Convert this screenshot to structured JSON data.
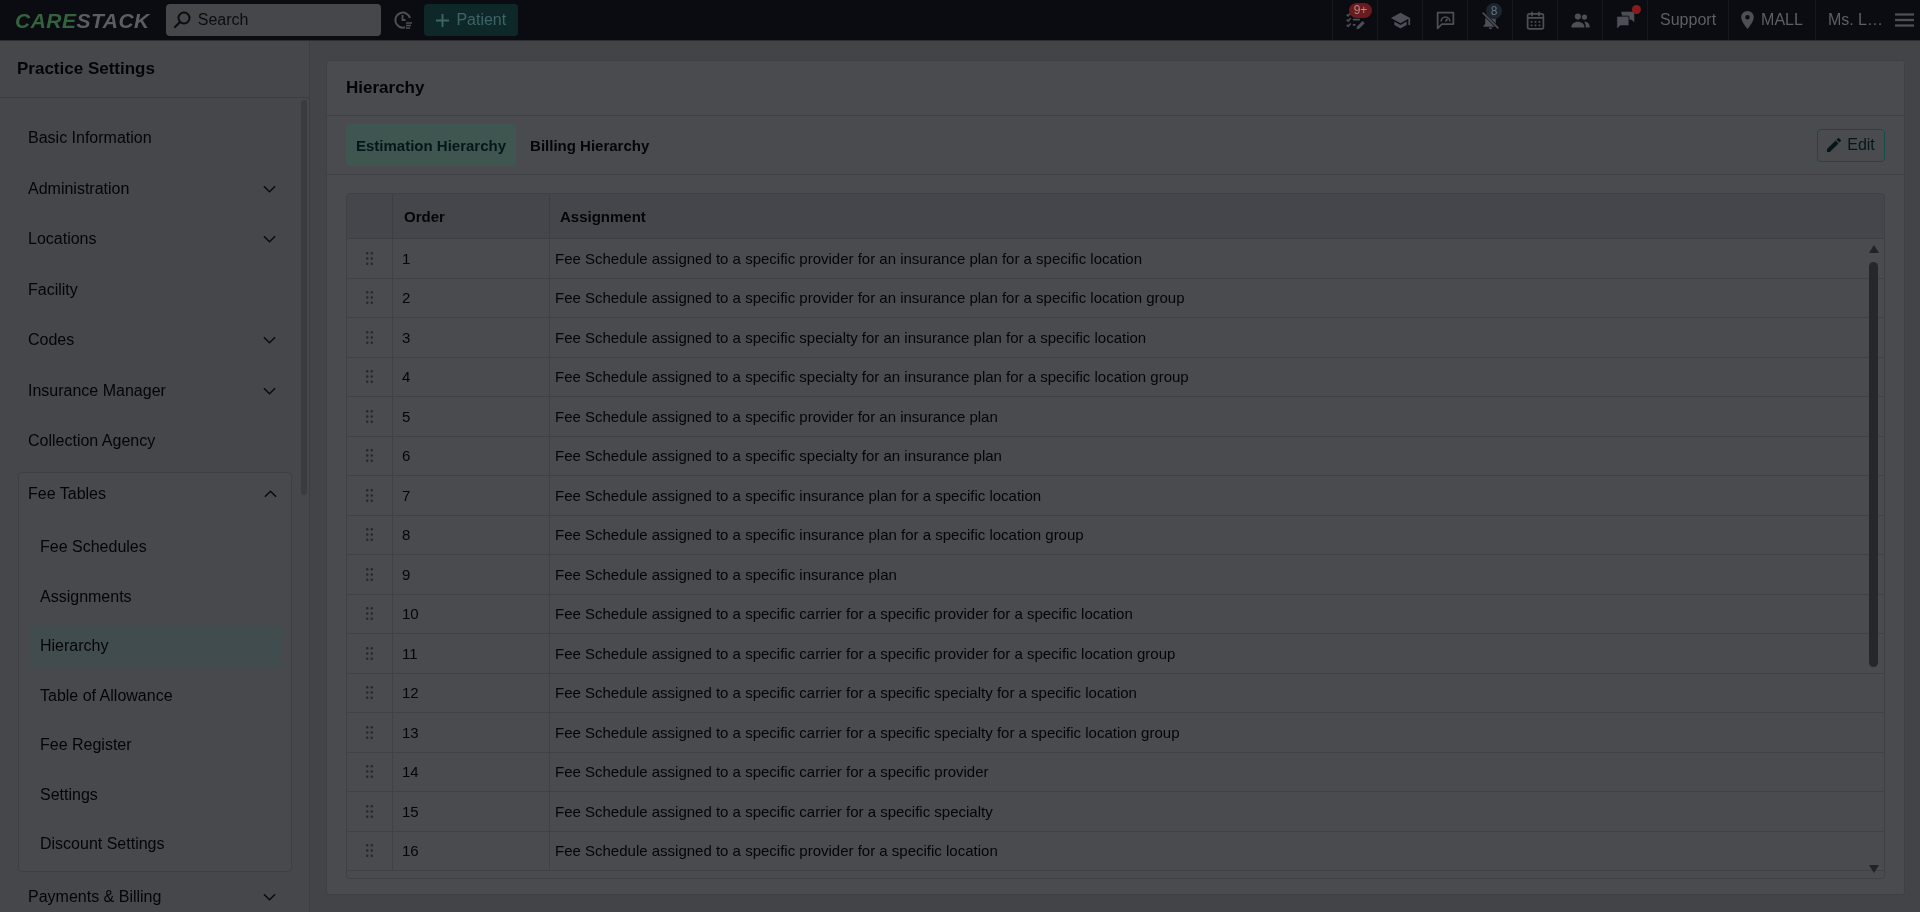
{
  "top_bar": {
    "logo": {
      "lead": "CARE",
      "rest": "STACK"
    },
    "search": {
      "placeholder": "Search"
    },
    "patient_button": "Patient",
    "icons": [
      {
        "kind": "tasks",
        "badge": {
          "text": "9+",
          "color": "#6b1a1d"
        },
        "alert": false
      },
      {
        "kind": "learning",
        "alert": false
      },
      {
        "kind": "feedback",
        "alert": false
      },
      {
        "kind": "notifications",
        "badge": {
          "text": "8",
          "color": "#1c2430"
        },
        "alert": false
      },
      {
        "kind": "calendar",
        "alert": false
      },
      {
        "kind": "people",
        "alert": false
      },
      {
        "kind": "messages",
        "alert": true
      }
    ],
    "support": "Support",
    "location": "MALL",
    "user": "Ms. L…"
  },
  "sidebar": {
    "title": "Practice Settings",
    "items": [
      {
        "kind": "link",
        "label": "Basic Information"
      },
      {
        "kind": "group",
        "label": "Administration",
        "expanded": false
      },
      {
        "kind": "group",
        "label": "Locations",
        "expanded": false
      },
      {
        "kind": "link",
        "label": "Facility"
      },
      {
        "kind": "group",
        "label": "Codes",
        "expanded": false
      },
      {
        "kind": "group",
        "label": "Insurance Manager",
        "expanded": false
      },
      {
        "kind": "link",
        "label": "Collection Agency"
      },
      {
        "kind": "group",
        "label": "Fee Tables",
        "expanded": true,
        "children": [
          {
            "label": "Fee Schedules",
            "selected": false
          },
          {
            "label": "Assignments",
            "selected": false
          },
          {
            "label": "Hierarchy",
            "selected": true
          },
          {
            "label": "Table of Allowance",
            "selected": false
          },
          {
            "label": "Fee Register",
            "selected": false
          },
          {
            "label": "Settings",
            "selected": false
          },
          {
            "label": "Discount Settings",
            "selected": false
          }
        ]
      },
      {
        "kind": "group",
        "label": "Payments & Billing",
        "expanded": false
      }
    ]
  },
  "main": {
    "title": "Hierarchy",
    "tabs": [
      {
        "label": "Estimation Hierarchy",
        "selected": true
      },
      {
        "label": "Billing Hierarchy",
        "selected": false
      }
    ],
    "edit_button": "Edit",
    "table": {
      "columns": [
        "Order",
        "Assignment"
      ],
      "rows": [
        {
          "order": "1",
          "assignment": "Fee Schedule assigned to a specific provider for an insurance plan for a specific location"
        },
        {
          "order": "2",
          "assignment": "Fee Schedule assigned to a specific provider for an insurance plan for a specific location group"
        },
        {
          "order": "3",
          "assignment": "Fee Schedule assigned to a specific specialty for an insurance plan for a specific location"
        },
        {
          "order": "4",
          "assignment": "Fee Schedule assigned to a specific specialty for an insurance plan for a specific location group"
        },
        {
          "order": "5",
          "assignment": "Fee Schedule assigned to a specific provider for an insurance plan"
        },
        {
          "order": "6",
          "assignment": "Fee Schedule assigned to a specific specialty for an insurance plan"
        },
        {
          "order": "7",
          "assignment": "Fee Schedule assigned to a specific insurance plan for a specific location"
        },
        {
          "order": "8",
          "assignment": "Fee Schedule assigned to a specific insurance plan for a specific location group"
        },
        {
          "order": "9",
          "assignment": "Fee Schedule assigned to a specific insurance plan"
        },
        {
          "order": "10",
          "assignment": "Fee Schedule assigned to a specific carrier for a specific provider for a specific location"
        },
        {
          "order": "11",
          "assignment": "Fee Schedule assigned to a specific carrier for a specific provider for a specific location group"
        },
        {
          "order": "12",
          "assignment": "Fee Schedule assigned to a specific carrier for a specific specialty for a specific location"
        },
        {
          "order": "13",
          "assignment": "Fee Schedule assigned to a specific carrier for a specific specialty for a specific location group"
        },
        {
          "order": "14",
          "assignment": "Fee Schedule assigned to a specific carrier for a specific provider"
        },
        {
          "order": "15",
          "assignment": "Fee Schedule assigned to a specific carrier for a specific specialty"
        },
        {
          "order": "16",
          "assignment": "Fee Schedule assigned to a specific provider for a specific location"
        }
      ]
    }
  }
}
